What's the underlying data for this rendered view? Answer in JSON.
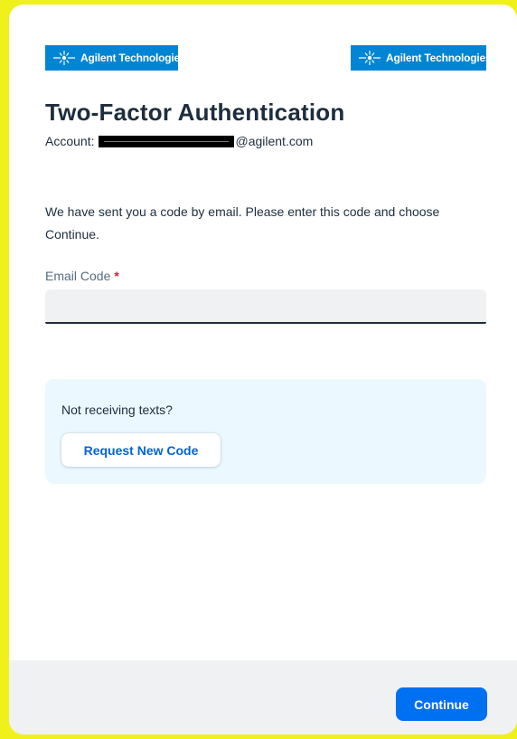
{
  "brand": {
    "logo_left_text": "Agilent Technologies",
    "logo_right_text": "Agilent Technologies",
    "logo_color": "#0085d5"
  },
  "page": {
    "title": "Two-Factor Authentication",
    "account_label": "Account:",
    "account_domain": "@agilent.com",
    "instructions": "We have sent you a code by email. Please enter this code and choose Continue."
  },
  "form": {
    "email_code_label": "Email Code",
    "required_marker": "*",
    "email_code_value": "",
    "email_code_placeholder": ""
  },
  "help": {
    "text": "Not receiving texts?",
    "request_button": "Request New Code"
  },
  "footer": {
    "continue_button": "Continue"
  },
  "colors": {
    "accent": "#0070f2",
    "link": "#0064d9",
    "required": "#d32030",
    "frame": "#f0f01a",
    "help_panel": "#ebf8ff"
  },
  "icons": {
    "logo_mark": "agilent-spark-icon"
  }
}
